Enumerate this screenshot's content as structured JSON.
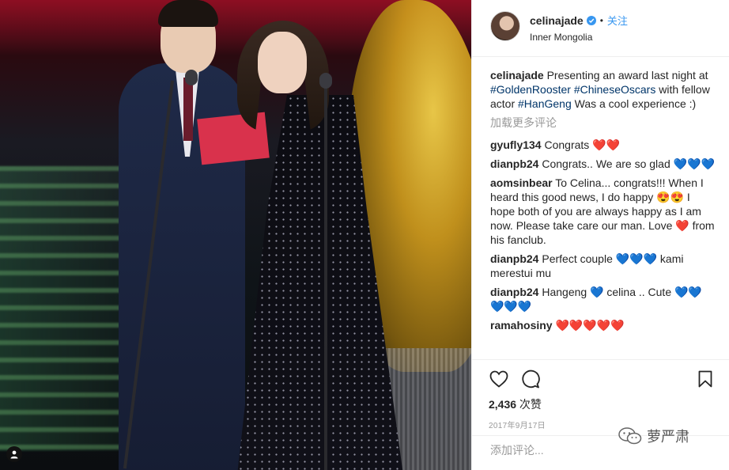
{
  "post": {
    "username": "celinajade",
    "separator": "•",
    "follow_label": "关注",
    "location": "Inner Mongolia"
  },
  "caption": {
    "username": "celinajade",
    "text_before": " Presenting an award last night at ",
    "tag1": "#GoldenRooster",
    "tag2": "#ChineseOscars",
    "text_mid": " with fellow actor ",
    "tag3": "#HanGeng",
    "text_after": " Was a cool experience :)"
  },
  "load_more_label": "加载更多评论",
  "comments": [
    {
      "user": "gyufly134",
      "text": " Congrats ",
      "emoji": "❤️❤️"
    },
    {
      "user": "dianpb24",
      "text": " Congrats.. We are so glad ",
      "emoji": "💙💙💙"
    },
    {
      "user": "aomsinbear",
      "text": " To Celina... congrats!!! When I heard this good news, I do happy 😍😍 I hope both of you are always happy as I am now. Please take care our man. Love ❤️ from his fanclub."
    },
    {
      "user": "dianpb24",
      "text": " Perfect couple ",
      "emoji": "💙💙💙",
      "text2": " kami merestui mu"
    },
    {
      "user": "dianpb24",
      "text": " Hangeng 💙 celina .. Cute ",
      "emoji": "💙💙💙💙💙"
    },
    {
      "user": "ramahosiny",
      "text": " ",
      "emoji": "❤️❤️❤️❤️❤️"
    }
  ],
  "actions": {
    "like_icon": "heart-outline-icon",
    "comment_icon": "comment-bubble-icon",
    "save_icon": "bookmark-icon"
  },
  "likes": {
    "count": "2,436",
    "unit": " 次赞"
  },
  "date": "2017年9月17日",
  "add_comment_placeholder": "添加评论...",
  "watermark": "萝严肃",
  "colors": {
    "link": "#003569",
    "accent": "#3897f0",
    "muted": "#999999"
  }
}
